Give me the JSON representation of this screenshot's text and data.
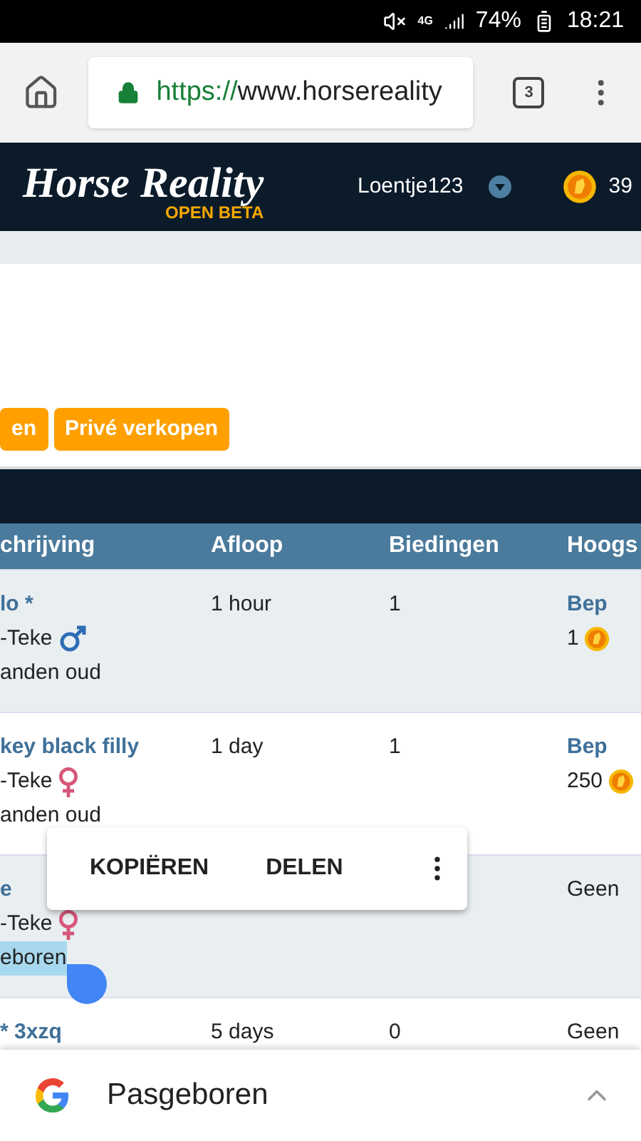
{
  "status_bar": {
    "network": "4G",
    "battery": "74%",
    "time": "18:21"
  },
  "browser": {
    "url_scheme": "https://",
    "url_rest": "www.horsereality",
    "tab_count": "3"
  },
  "site_header": {
    "logo": "Horse Reality",
    "logo_badge": "OPEN BETA",
    "username": "Loentje123",
    "coins": "39"
  },
  "buttons": [
    {
      "label": "en"
    },
    {
      "label": "Privé verkopen"
    }
  ],
  "table": {
    "columns": [
      "chrijving",
      "Afloop",
      "Biedingen",
      "Hoogs"
    ],
    "rows": [
      {
        "title": "lo *",
        "breed": "-Teke",
        "kind": "male",
        "age": "anden oud",
        "age_highlighted": false,
        "expires": "1 hour",
        "bids": "1",
        "bidder": "Bep",
        "amount": "1",
        "shaded": true
      },
      {
        "title": "key black filly",
        "breed": "-Teke",
        "kind": "female",
        "age": "anden oud",
        "age_highlighted": false,
        "expires": "1 day",
        "bids": "1",
        "bidder": "Bep",
        "amount": "250",
        "shaded": false
      },
      {
        "title": "e",
        "breed": "-Teke",
        "kind": "female",
        "age": "eboren",
        "age_highlighted": true,
        "bidder": "Geen",
        "shaded": true
      },
      {
        "title": "* 3xzq",
        "expires": "5 days",
        "bids": "0",
        "bidder": "Geen",
        "shaded": false
      }
    ]
  },
  "context_menu": {
    "items": [
      {
        "label": "KOPIËREN"
      },
      {
        "label": "DELEN"
      }
    ]
  },
  "search_bar": {
    "query": "Pasgeboren"
  }
}
